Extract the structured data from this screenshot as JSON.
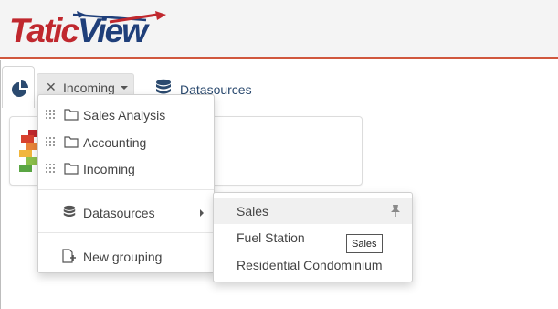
{
  "app": {
    "logo_part1": "Tatic",
    "logo_part2": "View"
  },
  "tabs": {
    "home_icon": "pie-chart-icon",
    "incoming_label": "Incoming",
    "datasources_label": "Datasources"
  },
  "dropdown": {
    "groups": [
      {
        "label": "Sales Analysis"
      },
      {
        "label": "Accounting"
      },
      {
        "label": "Incoming"
      }
    ],
    "datasources_label": "Datasources",
    "new_grouping_label": "New grouping"
  },
  "submenu": {
    "items": [
      {
        "label": "Sales"
      },
      {
        "label": "Fuel Station"
      },
      {
        "label": "Residential Condominium"
      }
    ]
  },
  "tooltip": {
    "text": "Sales"
  },
  "colors": {
    "brand_red": "#c0282e",
    "brand_blue": "#1f3f7a",
    "accent_line": "#d0573d"
  }
}
